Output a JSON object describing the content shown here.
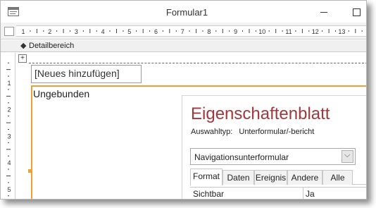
{
  "window": {
    "title": "Formular1"
  },
  "ruler": {
    "numbers": [
      "1",
      "2",
      "3",
      "4",
      "5",
      "6",
      "7",
      "8",
      "9",
      "10",
      "11",
      "12",
      "13"
    ]
  },
  "vruler": {
    "numbers": [
      "1",
      "2",
      "3",
      "4",
      "5"
    ]
  },
  "section": {
    "label": "Detailbereich"
  },
  "design": {
    "add_field_label": "[Neues hinzufügen]",
    "subform_label": "Ungebunden"
  },
  "property_sheet": {
    "title": "Eigenschaftenblatt",
    "selection_type_label": "Auswahltyp:",
    "selection_type_value": "Unterformular/-bericht",
    "selected_object": "Navigationsunterformular",
    "tabs": [
      "Format",
      "Daten",
      "Ereignis",
      "Andere",
      "Alle"
    ],
    "active_tab": "Format",
    "rows": [
      {
        "name": "Sichtbar",
        "value": "Ja"
      }
    ]
  },
  "colors": {
    "accent": "#a4373a",
    "selection": "#f0a030"
  },
  "icons": [
    "form-icon",
    "minimize-icon",
    "maximize-icon",
    "move-handle-icon",
    "section-arrow-icon",
    "dropdown-arrow-icon"
  ]
}
